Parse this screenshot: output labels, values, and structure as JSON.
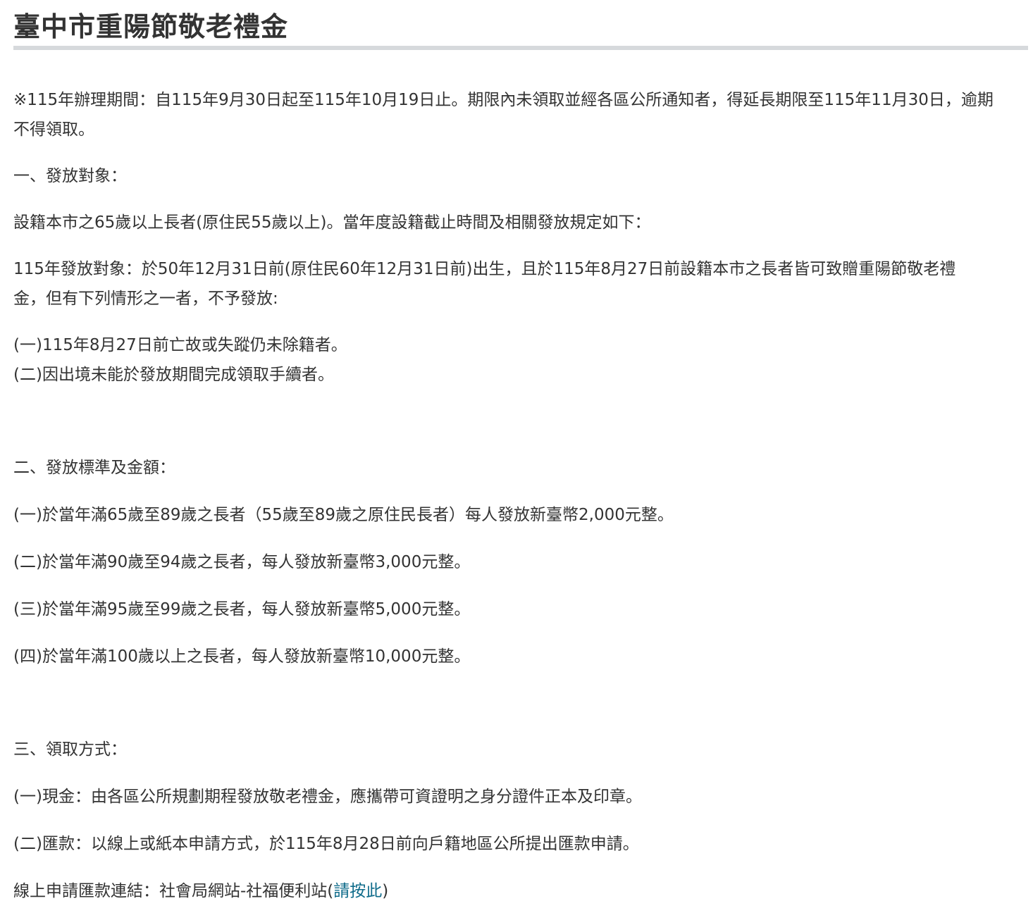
{
  "page_title": "臺中市重陽節敬老禮金",
  "notice": {
    "line1": "※115年辦理期間：自115年9月30日起至115年10月19日止。期限內未領取並經各區公所通知者，得延長期限至115年11月30日，逾期",
    "line2": "不得領取。"
  },
  "section1": {
    "heading": "一、發放對象：",
    "intro": "設籍本市之65歲以上長者(原住民55歲以上)。當年度設籍截止時間及相關發放規定如下：",
    "target_line1": "115年發放對象：於50年12月31日前(原住民60年12月31日前)出生，且於115年8月27日前設籍本市之長者皆可致贈重陽節敬老禮",
    "target_line2": "金，但有下列情形之一者，不予發放:",
    "exclusions": [
      "(一)115年8月27日前亡故或失蹤仍未除籍者。",
      "(二)因出境未能於發放期間完成領取手續者。"
    ]
  },
  "section2": {
    "heading": "二、發放標準及金額：",
    "items": [
      "(一)於當年滿65歲至89歲之長者（55歲至89歲之原住民長者）每人發放新臺幣2,000元整。",
      "(二)於當年滿90歲至94歲之長者，每人發放新臺幣3,000元整。",
      "(三)於當年滿95歲至99歲之長者，每人發放新臺幣5,000元整。",
      "(四)於當年滿100歲以上之長者，每人發放新臺幣10,000元整。"
    ]
  },
  "section3": {
    "heading": "三、領取方式：",
    "items": [
      "(一)現金：由各區公所規劃期程發放敬老禮金，應攜帶可資證明之身分證件正本及印章。",
      "(二)匯款：以線上或紙本申請方式，於115年8月28日前向戶籍地區公所提出匯款申請。"
    ],
    "online_prefix": "線上申請匯款連結：社會局網站-社福便利站(",
    "online_link": "請按此",
    "online_suffix": ")"
  },
  "colors": {
    "text": "#333333",
    "link": "#0e6b8a",
    "rule": "#d6d9dc"
  }
}
